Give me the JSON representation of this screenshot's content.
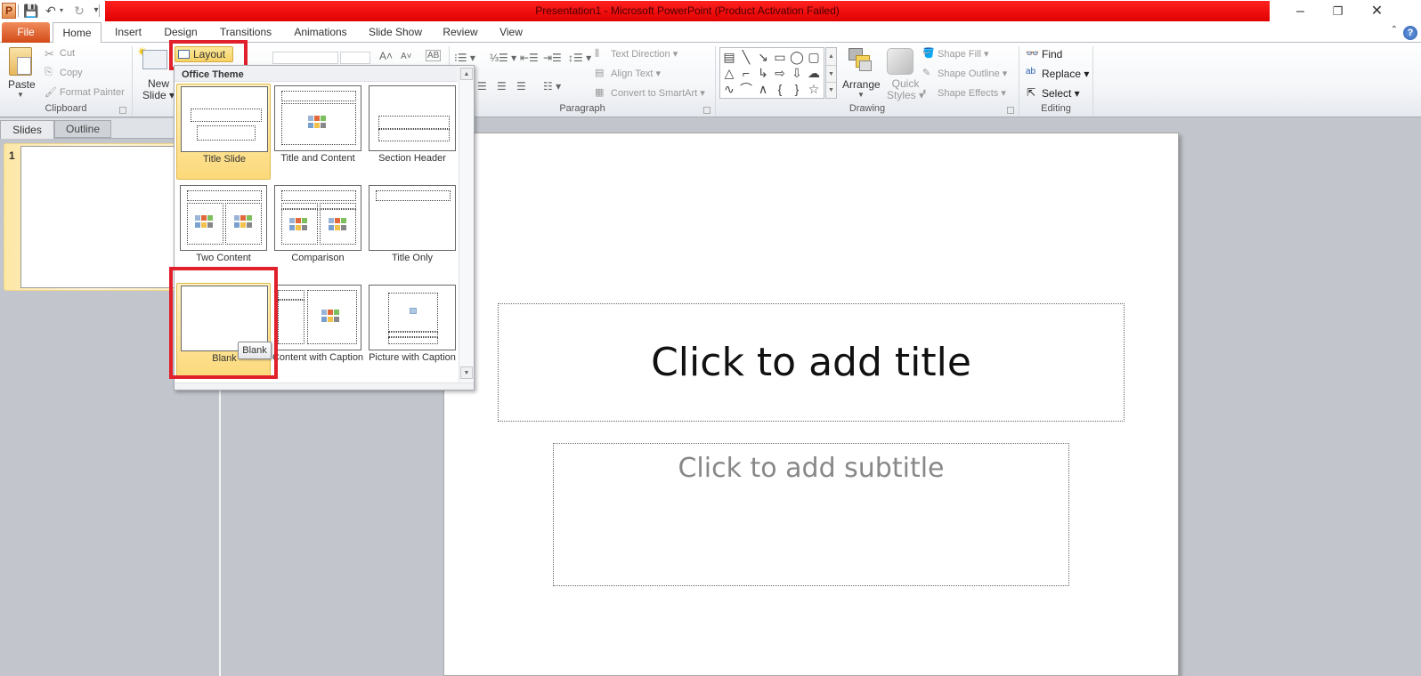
{
  "window": {
    "title": "Presentation1  -  Microsoft PowerPoint (Product Activation Failed)",
    "app_icon": "P",
    "minimize": "–",
    "restore": "❐",
    "close": "✕"
  },
  "quick_access": {
    "save_icon": "💾",
    "undo_icon": "↶",
    "undo_dropdown": "▾",
    "redo_icon": "↻",
    "customize_icon": "▾"
  },
  "ribbon_tabs": [
    "File",
    "Home",
    "Insert",
    "Design",
    "Transitions",
    "Animations",
    "Slide Show",
    "Review",
    "View"
  ],
  "help": {
    "minimize_ribbon": "⌃",
    "help_icon": "?"
  },
  "clipboard": {
    "paste": "Paste",
    "cut": "Cut",
    "copy": "Copy",
    "format_painter": "Format Painter",
    "group_label": "Clipboard"
  },
  "slides_group": {
    "new_slide_line1": "New",
    "new_slide_line2": "Slide ▾",
    "layout": "Layout ▾"
  },
  "paragraph": {
    "text_direction": "Text Direction ▾",
    "align_text": "Align Text ▾",
    "convert_smartart": "Convert to SmartArt ▾",
    "group_label": "Paragraph"
  },
  "drawing": {
    "shapes": [
      "▤",
      "╲",
      "↘",
      "▭",
      "◯",
      "▢",
      "△",
      "⌐",
      "↳",
      "⇨",
      "⇩",
      "☁",
      "∿",
      "⌒",
      "∧",
      "{",
      "}",
      "☆"
    ],
    "arrange": "Arrange",
    "quick_styles_line1": "Quick",
    "quick_styles_line2": "Styles ▾",
    "shape_fill": "Shape Fill ▾",
    "shape_outline": "Shape Outline ▾",
    "shape_effects": "Shape Effects ▾",
    "group_label": "Drawing"
  },
  "editing": {
    "find": "Find",
    "replace": "Replace ▾",
    "select": "Select ▾",
    "group_label": "Editing"
  },
  "left_pane": {
    "tabs": [
      "Slides",
      "Outline"
    ],
    "slide_number": "1"
  },
  "slide": {
    "title_placeholder": "Click to add title",
    "subtitle_placeholder": "Click to add subtitle"
  },
  "layout_menu": {
    "header": "Office Theme",
    "items": [
      {
        "label": "Title Slide",
        "selected": true
      },
      {
        "label": "Title and Content",
        "selected": false
      },
      {
        "label": "Section Header",
        "selected": false
      },
      {
        "label": "Two Content",
        "selected": false
      },
      {
        "label": "Comparison",
        "selected": false
      },
      {
        "label": "Title Only",
        "selected": false
      },
      {
        "label": "Blank",
        "selected": true
      },
      {
        "label": "Content with Caption",
        "selected": false
      },
      {
        "label": "Picture with Caption",
        "selected": false
      }
    ],
    "tooltip": "Blank"
  },
  "colors": {
    "title_bar_red": "#e00000",
    "file_tab": "#d24a18",
    "highlight_box": "#e0202a",
    "selection_gold": "#fcd97a"
  }
}
